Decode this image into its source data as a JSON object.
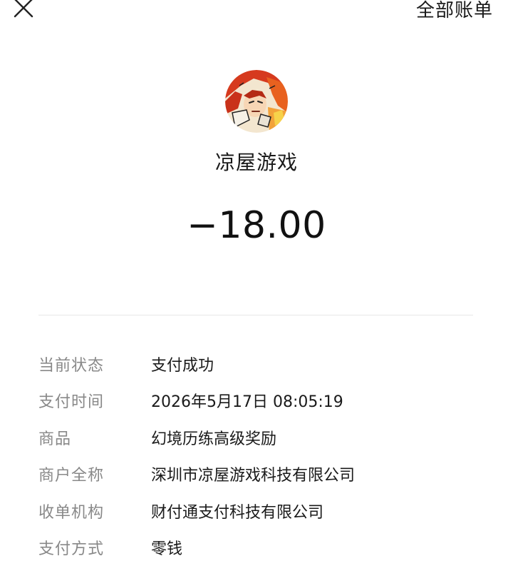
{
  "header": {
    "all_bills_label": "全部账单",
    "close_icon": "close-icon"
  },
  "merchant": {
    "name": "凉屋游戏",
    "avatar_icon": "merchant-avatar"
  },
  "transaction": {
    "amount": "−18.00"
  },
  "details": [
    {
      "label": "当前状态",
      "value": "支付成功"
    },
    {
      "label": "支付时间",
      "value": "2026年5月17日 08:05:19"
    },
    {
      "label": "商品",
      "value": "幻境历练高级奖励"
    },
    {
      "label": "商户全称",
      "value": "深圳市凉屋游戏科技有限公司"
    },
    {
      "label": "收单机构",
      "value": "财付通支付科技有限公司"
    },
    {
      "label": "支付方式",
      "value": "零钱"
    }
  ],
  "colors": {
    "label_gray": "#888888",
    "text_dark": "#1a1a1a",
    "divider": "#e8e8e8"
  }
}
